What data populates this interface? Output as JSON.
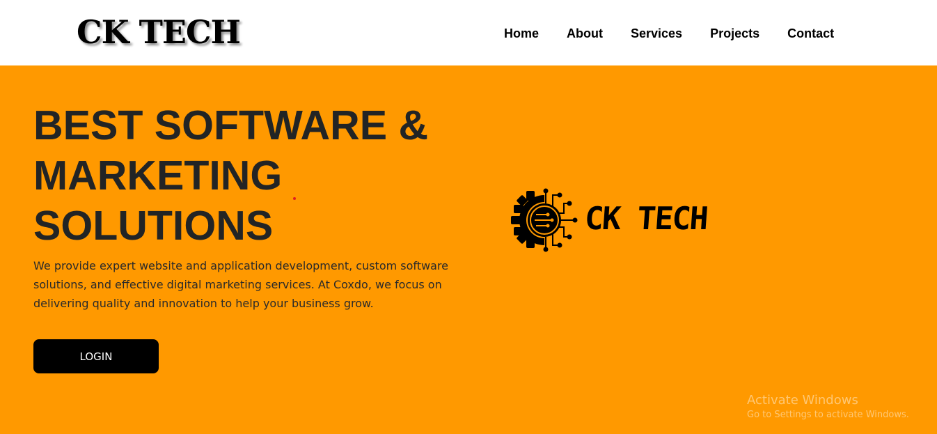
{
  "header": {
    "brand": "CK TECH",
    "nav": [
      "Home",
      "About",
      "Services",
      "Projects",
      "Contact"
    ]
  },
  "hero": {
    "title_lines": [
      "BEST SOFTWARE &",
      "MARKETING",
      "SOLUTIONS"
    ],
    "description": "We provide expert website and application development, custom software solutions, and effective digital marketing services. At Coxdo, we focus on delivering quality and innovation to help your business grow.",
    "login_label": "LOGIN",
    "logo_text": "CK TECH",
    "logo_icon": "gear-circuit-icon"
  },
  "watermark": {
    "title": "Activate Windows",
    "subtitle": "Go to Settings to activate Windows."
  },
  "colors": {
    "accent": "#ff9900",
    "text_dark": "#222425",
    "button": "#000000"
  }
}
